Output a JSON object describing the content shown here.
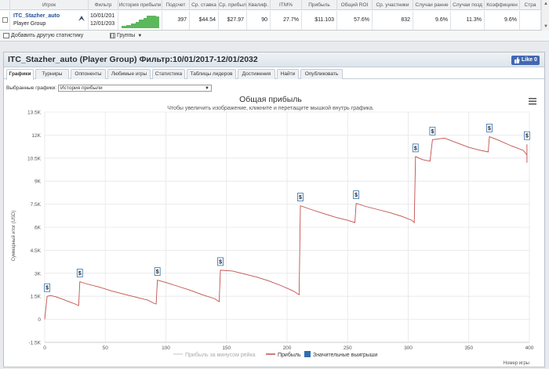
{
  "table": {
    "headers": [
      "Игрок",
      "Фильтр",
      "История прибыли",
      "Подсчет",
      "Ср. ставка",
      "Ср. прибыль",
      "Квалиф.",
      "ITM%",
      "Прибыль",
      "Общий ROI",
      "Ср. участники",
      "Случаи ранне",
      "Случаи позд",
      "Коэффициен",
      "Стра"
    ],
    "player_name": "ITC_Stazher_auto",
    "player_group": "Player Group",
    "filter_from": "10/01/201",
    "filter_to": "12/01/203",
    "count": "397",
    "avg_bet": "$44.54",
    "avg_profit": "$27.97",
    "qualif": "90",
    "itm": "27.7%",
    "profit": "$11.103",
    "roi": "57.6%",
    "avg_participants": "832",
    "early_cases": "9.6%",
    "late_cases": "11.3%",
    "coefficient": "9.6%"
  },
  "toolbar": {
    "add_stat": "Добавить другую статистику",
    "groups": "Группы"
  },
  "panel": {
    "title": "ITC_Stazher_auto (Player Group) Фильтр:10/01/2017-12/01/2032",
    "fb_like": "Like 0"
  },
  "tabs": [
    "Графики",
    "Турниры",
    "Оппоненты",
    "Любимые игры",
    "Статистика",
    "Таблицы лидеров",
    "Достижения",
    "Найти",
    "Опубликовать"
  ],
  "selector": {
    "label": "Выбранные графики:",
    "value": "История прибыли"
  },
  "colors": {
    "profit_line": "#c0504d",
    "rake_line": "#d8d8d8",
    "wins_marker": "#2f6fb0"
  },
  "chart_data": {
    "type": "line",
    "title": "Общая прибыль",
    "subtitle": "Чтобы увеличить изображение, кликните и перетащите мышкой внутрь графика.",
    "ylabel": "Суммарный итог (USD)",
    "xlabel": "Номер игры",
    "xlim": [
      0,
      400
    ],
    "ylim": [
      -1500,
      13500
    ],
    "x_ticks": [
      "0",
      "50",
      "100",
      "150",
      "200",
      "250",
      "300",
      "350",
      "400"
    ],
    "y_ticks": [
      "-1.5K",
      "0",
      "1.5K",
      "3K",
      "4.5K",
      "6K",
      "7.5K",
      "9K",
      "10.5K",
      "12K",
      "13.5K"
    ],
    "legend": [
      "Прибыль за минусом рейка",
      "Прибыль",
      "Значительные выигрыши"
    ],
    "legend_position": "bottom",
    "grid": true,
    "series": [
      {
        "name": "Прибыль",
        "points": [
          [
            0,
            0
          ],
          [
            2,
            1500
          ],
          [
            5,
            1550
          ],
          [
            10,
            1450
          ],
          [
            15,
            1300
          ],
          [
            20,
            1150
          ],
          [
            25,
            1000
          ],
          [
            28,
            900
          ],
          [
            29,
            2450
          ],
          [
            35,
            2300
          ],
          [
            45,
            2100
          ],
          [
            55,
            1850
          ],
          [
            65,
            1650
          ],
          [
            75,
            1450
          ],
          [
            85,
            1250
          ],
          [
            90,
            1050
          ],
          [
            92,
            1000
          ],
          [
            93,
            2550
          ],
          [
            100,
            2400
          ],
          [
            110,
            2150
          ],
          [
            120,
            1900
          ],
          [
            130,
            1600
          ],
          [
            140,
            1350
          ],
          [
            144,
            1150
          ],
          [
            145,
            3200
          ],
          [
            155,
            3150
          ],
          [
            165,
            2950
          ],
          [
            175,
            2750
          ],
          [
            185,
            2500
          ],
          [
            195,
            2200
          ],
          [
            205,
            1850
          ],
          [
            210,
            1600
          ],
          [
            211,
            7400
          ],
          [
            220,
            7150
          ],
          [
            230,
            6900
          ],
          [
            240,
            6650
          ],
          [
            250,
            6450
          ],
          [
            256,
            6300
          ],
          [
            257,
            7550
          ],
          [
            265,
            7350
          ],
          [
            275,
            7150
          ],
          [
            285,
            6950
          ],
          [
            295,
            6700
          ],
          [
            303,
            6450
          ],
          [
            305,
            6300
          ],
          [
            306,
            10600
          ],
          [
            312,
            10400
          ],
          [
            318,
            10300
          ],
          [
            320,
            11700
          ],
          [
            330,
            11800
          ],
          [
            340,
            11500
          ],
          [
            350,
            11200
          ],
          [
            360,
            11000
          ],
          [
            366,
            10900
          ],
          [
            367,
            11900
          ],
          [
            375,
            11650
          ],
          [
            385,
            11300
          ],
          [
            395,
            11000
          ],
          [
            405,
            10700
          ],
          [
            415,
            10500
          ],
          [
            425,
            10300
          ],
          [
            432,
            10200
          ],
          [
            434,
            11400
          ]
        ]
      }
    ],
    "big_wins_x": [
      2,
      29,
      93,
      145,
      211,
      257,
      306,
      320,
      367,
      434
    ],
    "big_wins_label": "$"
  }
}
